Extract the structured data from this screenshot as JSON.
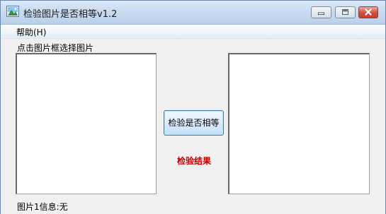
{
  "window": {
    "title": "检验图片是否相等v1.2",
    "controls": {
      "minimize": "minimize",
      "maximize": "maximize",
      "close": "close"
    }
  },
  "menu": {
    "help": "帮助(H)"
  },
  "main": {
    "hint": "点击图片框选择图片",
    "compare_button": "检验是否相等",
    "result_label": "检验结果",
    "image1_info_label": "图片1信息:",
    "image1_info_value": "无"
  },
  "colors": {
    "result_text": "#c00000",
    "titlebar": "#c9dbf0",
    "close_button": "#cf4f3e"
  },
  "icons": [
    "app-picture-icon",
    "minimize-icon",
    "maximize-icon",
    "close-icon"
  ]
}
